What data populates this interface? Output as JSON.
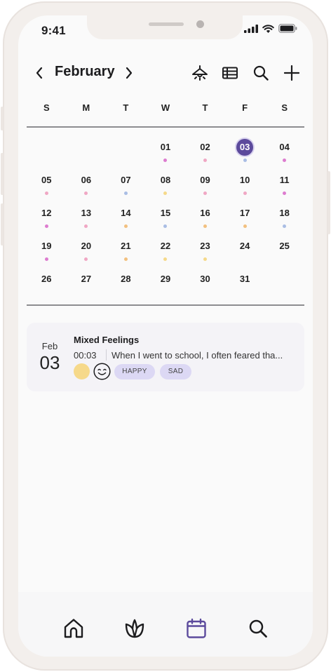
{
  "status_bar": {
    "time": "9:41"
  },
  "header": {
    "month": "February"
  },
  "weekdays": [
    "S",
    "M",
    "T",
    "W",
    "T",
    "F",
    "S"
  ],
  "calendar": {
    "selected_day": "03",
    "weeks": [
      [
        {
          "d": "",
          "dot": null
        },
        {
          "d": "",
          "dot": null
        },
        {
          "d": "",
          "dot": null
        },
        {
          "d": "01",
          "dot": "#dd7ccf"
        },
        {
          "d": "02",
          "dot": "#f0a7c4"
        },
        {
          "d": "03",
          "dot": "#a9bde4"
        },
        {
          "d": "04",
          "dot": "#dd7ccf"
        }
      ],
      [
        {
          "d": "05",
          "dot": "#f0a7c4"
        },
        {
          "d": "06",
          "dot": "#f0a7c4"
        },
        {
          "d": "07",
          "dot": "#a9bde4"
        },
        {
          "d": "08",
          "dot": "#f5d98a"
        },
        {
          "d": "09",
          "dot": "#f0a7c4"
        },
        {
          "d": "10",
          "dot": "#f0a7c4"
        },
        {
          "d": "11",
          "dot": "#dd7ccf"
        }
      ],
      [
        {
          "d": "12",
          "dot": "#dd7ccf"
        },
        {
          "d": "13",
          "dot": "#f0a7c4"
        },
        {
          "d": "14",
          "dot": "#f2c07f"
        },
        {
          "d": "15",
          "dot": "#a9bde4"
        },
        {
          "d": "16",
          "dot": "#f2c07f"
        },
        {
          "d": "17",
          "dot": "#f2c07f"
        },
        {
          "d": "18",
          "dot": "#a9bde4"
        }
      ],
      [
        {
          "d": "19",
          "dot": "#dd7ccf"
        },
        {
          "d": "20",
          "dot": "#f0a7c4"
        },
        {
          "d": "21",
          "dot": "#f2c07f"
        },
        {
          "d": "22",
          "dot": "#f5d98a"
        },
        {
          "d": "23",
          "dot": "#f5d98a"
        },
        {
          "d": "24",
          "dot": null
        },
        {
          "d": "25",
          "dot": null
        }
      ],
      [
        {
          "d": "26",
          "dot": null
        },
        {
          "d": "27",
          "dot": null
        },
        {
          "d": "28",
          "dot": null
        },
        {
          "d": "29",
          "dot": null
        },
        {
          "d": "30",
          "dot": null
        },
        {
          "d": "31",
          "dot": null
        },
        {
          "d": "",
          "dot": null
        }
      ]
    ]
  },
  "entry": {
    "month": "Feb",
    "day": "03",
    "title": "Mixed Feelings",
    "time": "00:03",
    "text": "When I went to school, I often feared tha...",
    "mood_color": "#f6d98a",
    "mood_icon": "smiling-face-icon",
    "tags": [
      "HAPPY",
      "SAD"
    ]
  },
  "tabbar": {
    "items": [
      "home-icon",
      "lotus-icon",
      "calendar-icon",
      "search-icon"
    ],
    "active": "calendar-icon",
    "active_color": "#5c4a9c"
  },
  "colors": {
    "accent": "#5c4a9c",
    "tag_bg": "#dcd8f4"
  }
}
